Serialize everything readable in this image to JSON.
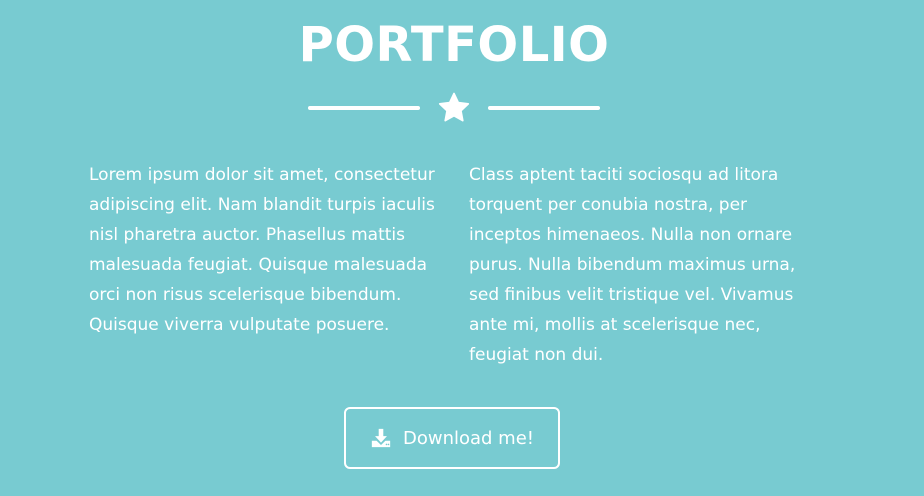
{
  "portfolio": {
    "title": "PORTFOLIO",
    "divider_icon": "star-icon",
    "paragraph_left": "Lorem ipsum dolor sit amet, consectetur adipiscing elit. Nam blandit turpis iaculis nisl pharetra auctor. Phasellus mattis malesuada feugiat. Quisque malesuada orci non risus scelerisque bibendum. Quisque viverra vulputate posuere.",
    "paragraph_right": "Class aptent taciti sociosqu ad litora torquent per conubia nostra, per inceptos himenaeos. Nulla non ornare purus. Nulla bibendum maximus urna, sed finibus velit tristique vel. Vivamus ante mi, mollis at scelerisque nec, feugiat non dui.",
    "download_button": {
      "label": "Download me!",
      "icon": "download-icon"
    }
  },
  "colors": {
    "background": "#78cbd1",
    "foreground": "#ffffff"
  }
}
